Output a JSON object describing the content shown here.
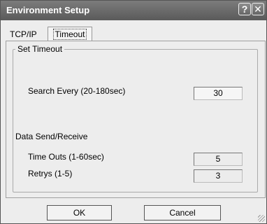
{
  "window": {
    "title": "Environment Setup",
    "help_button": "?",
    "close_button": "✕"
  },
  "tabs": [
    {
      "label": "TCP/IP",
      "active": false
    },
    {
      "label": "Timeout",
      "active": true
    }
  ],
  "group": {
    "title": "Set Timeout",
    "search_every": {
      "label": "Search Every (20-180sec)",
      "value": "30"
    },
    "section_label": "Data Send/Receive",
    "time_outs": {
      "label": "Time Outs (1-60sec)",
      "value": "5"
    },
    "retrys": {
      "label": "Retrys (1-5)",
      "value": "3"
    }
  },
  "buttons": {
    "ok": "OK",
    "cancel": "Cancel"
  }
}
